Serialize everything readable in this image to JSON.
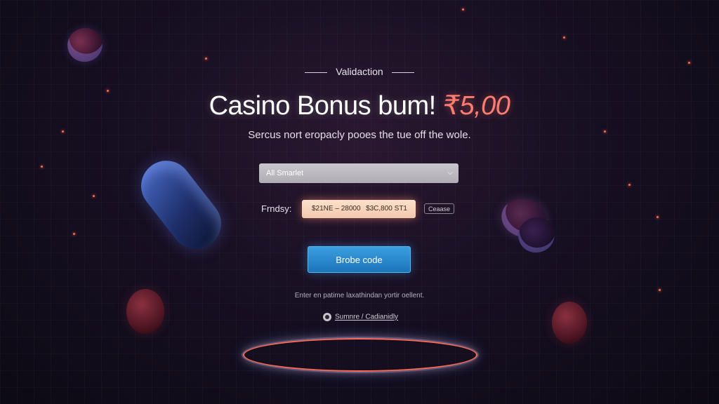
{
  "header": {
    "overline": "Validaction",
    "title": "Casino Bonus bum!",
    "amount": "₹5,00",
    "subtitle": "Sercus nort eropacly pooes the tue off the wole."
  },
  "form": {
    "select_value": "All Smarlet",
    "range_label": "Frndsy:",
    "range_from": "$21NE – 28000",
    "range_to": "$3C,800 ST1",
    "small_button": "Ceaase",
    "primary_button": "Brobe code",
    "helper_text": "Enter en patime laxathindan yortir oellent.",
    "footer_link": "Sumnre / Cadianidly"
  },
  "colors": {
    "accent_amount": "#ff7d70",
    "primary_button": "#2a8ad0",
    "range_box": "#f6d2bb",
    "background": "#170f22"
  },
  "icons": {
    "select_chevron": "chevron-down-icon",
    "footer_icon": "radio-icon"
  }
}
